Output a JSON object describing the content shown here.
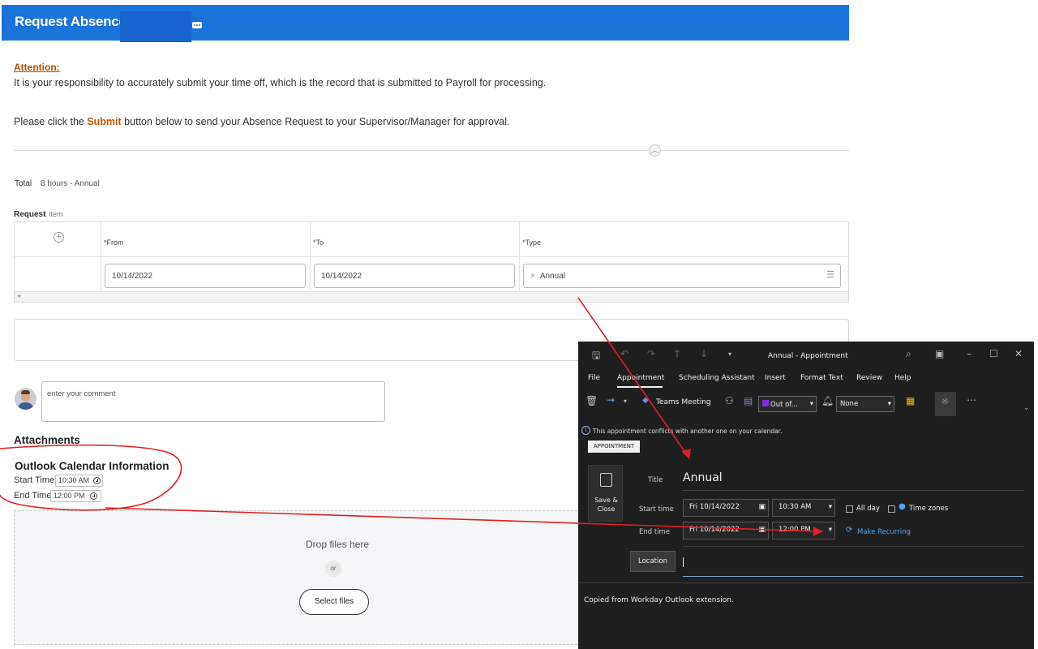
{
  "header": {
    "title": "Request Absence"
  },
  "attention": {
    "label": "Attention:",
    "text": "It is your responsibility to accurately submit your time off, which is the record that is submitted to Payroll for processing.",
    "instruction_prefix": "Please click the ",
    "instruction_bold": "Submit",
    "instruction_suffix": " button below to send your Absence Request to your Supervisor/Manager for approval."
  },
  "summary": {
    "total_label": "Total",
    "total_value": "8 hours - Annual"
  },
  "request": {
    "label": "Request",
    "count": "1 item",
    "columns": [
      "*From",
      "*To",
      "*Type"
    ],
    "row": {
      "from": "10/14/2022",
      "to": "10/14/2022",
      "type": "Annual",
      "type_remove": "×"
    }
  },
  "comment": {
    "placeholder": "enter your comment"
  },
  "attachments": {
    "heading": "Attachments",
    "outlook_heading": "Outlook Calendar Information",
    "start_label": "Start Time:",
    "start_value": "10:30 AM",
    "end_label": "End Time:",
    "end_value": "12:00 PM",
    "drop_text": "Drop files here",
    "or_text": "or",
    "select_files": "Select files"
  },
  "outlook": {
    "window_title": "Annual  -  Appointment",
    "menu": [
      "File",
      "Appointment",
      "Scheduling Assistant",
      "Insert",
      "Format Text",
      "Review",
      "Help"
    ],
    "toolbar": {
      "teams": "Teams Meeting",
      "show_as": "Out of...",
      "reminder": "None"
    },
    "conflict": "This appointment conflicts with another one on your calendar.",
    "tag": "APPOINTMENT",
    "save_close": "Save & Close",
    "title_label": "Title",
    "title_value": "Annual",
    "start_label": "Start time",
    "start_date": "Fri 10/14/2022",
    "start_time": "10:30 AM",
    "end_label": "End time",
    "end_date": "Fri 10/14/2022",
    "end_time": "12:00 PM",
    "all_day": "All day",
    "time_zones": "Time zones",
    "make_recurring": "Make Recurring",
    "location_label": "Location",
    "body_text": "Copied from Workday Outlook extension."
  },
  "colors": {
    "header_bg": "#1a73d8",
    "annotation": "#e02020",
    "outlook_bg": "#1f1f1f"
  }
}
